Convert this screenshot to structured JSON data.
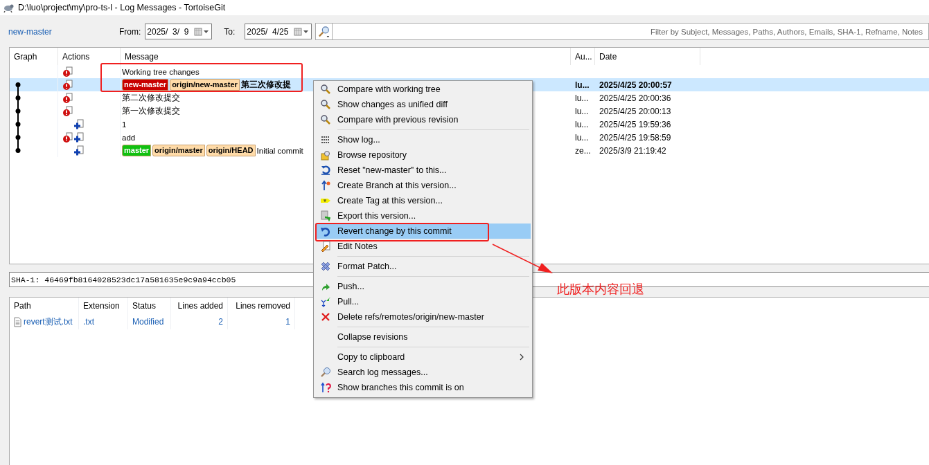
{
  "window": {
    "title": "D:\\luo\\project\\my\\pro-ts-l - Log Messages - TortoiseGit"
  },
  "toolbar": {
    "branch": "new-master",
    "from_label": "From:",
    "from_value": "2025/  3/  9",
    "to_label": "To:",
    "to_value": "2025/  4/25",
    "search": {
      "placeholder": "Filter by Subject, Messages, Paths, Authors, Emails, SHA-1, Refname, Notes"
    }
  },
  "log": {
    "columns": [
      "Graph",
      "Actions",
      "Message",
      "Au...",
      "Date"
    ],
    "rows": [
      {
        "graph_node": false,
        "modified": true,
        "added": false,
        "refs": [],
        "message": "Working tree changes",
        "author": "",
        "date": "",
        "selected": false
      },
      {
        "graph_node": true,
        "modified": true,
        "added": false,
        "refs": [
          {
            "name": "new-master",
            "color": "#c80000"
          },
          {
            "name": "origin/new-master",
            "color": "#ffdba8"
          }
        ],
        "message": "第三次修改提",
        "author": "lu...",
        "date": "2025/4/25 20:00:57",
        "selected": true
      },
      {
        "graph_node": true,
        "modified": true,
        "added": false,
        "refs": [],
        "message": "第二次修改提交",
        "author": "lu...",
        "date": "2025/4/25 20:00:36",
        "selected": false
      },
      {
        "graph_node": true,
        "modified": true,
        "added": false,
        "refs": [],
        "message": "第一次修改提交",
        "author": "lu...",
        "date": "2025/4/25 20:00:13",
        "selected": false
      },
      {
        "graph_node": true,
        "modified": false,
        "added": true,
        "refs": [],
        "message": "1",
        "author": "lu...",
        "date": "2025/4/25 19:59:36",
        "selected": false
      },
      {
        "graph_node": true,
        "modified": true,
        "added": true,
        "refs": [],
        "message": "add",
        "author": "lu...",
        "date": "2025/4/25 19:58:59",
        "selected": false
      },
      {
        "graph_node": true,
        "modified": false,
        "added": true,
        "refs": [
          {
            "name": "master",
            "color": "#10c010"
          },
          {
            "name": "origin/master",
            "color": "#ffdba8"
          },
          {
            "name": "origin/HEAD",
            "color": "#ffdba8"
          }
        ],
        "message": "Initial commit",
        "author": "ze...",
        "date": "2025/3/9 21:19:42",
        "selected": false
      }
    ]
  },
  "sha": "SHA-1: 46469fb8164028523dc17a581635e9c9a94ccb05",
  "files": {
    "columns": [
      "Path",
      "Extension",
      "Status",
      "Lines added",
      "Lines removed"
    ],
    "rows": [
      {
        "path": "revert测试.txt",
        "extension": ".txt",
        "status": "Modified",
        "lines_added": "2",
        "lines_removed": "1"
      }
    ]
  },
  "context_menu": [
    {
      "kind": "item",
      "label": "Compare with working tree",
      "selected": false
    },
    {
      "kind": "item",
      "label": "Show changes as unified diff",
      "selected": false
    },
    {
      "kind": "item",
      "label": "Compare with previous revision",
      "selected": false
    },
    {
      "kind": "separator"
    },
    {
      "kind": "item",
      "label": "Show log...",
      "selected": false
    },
    {
      "kind": "item",
      "label": "Browse repository",
      "selected": false
    },
    {
      "kind": "item",
      "label": "Reset \"new-master\" to this...",
      "selected": false
    },
    {
      "kind": "item",
      "label": "Create Branch at this version...",
      "selected": false
    },
    {
      "kind": "item",
      "label": "Create Tag at this version...",
      "selected": false
    },
    {
      "kind": "item",
      "label": "Export this version...",
      "selected": false
    },
    {
      "kind": "item",
      "label": "Revert change by this commit",
      "selected": true
    },
    {
      "kind": "item",
      "label": "Edit Notes",
      "selected": false
    },
    {
      "kind": "separator"
    },
    {
      "kind": "item",
      "label": "Format Patch...",
      "selected": false
    },
    {
      "kind": "separator"
    },
    {
      "kind": "item",
      "label": "Push...",
      "selected": false
    },
    {
      "kind": "item",
      "label": "Pull...",
      "selected": false
    },
    {
      "kind": "item",
      "label": "Delete refs/remotes/origin/new-master",
      "selected": false
    },
    {
      "kind": "separator"
    },
    {
      "kind": "item",
      "label": "Collapse revisions",
      "selected": false
    },
    {
      "kind": "separator"
    },
    {
      "kind": "item",
      "label": "Copy to clipboard",
      "selected": false,
      "submenu": true
    },
    {
      "kind": "item",
      "label": "Search log messages...",
      "selected": false
    },
    {
      "kind": "item",
      "label": "Show branches this commit is on",
      "selected": false
    }
  ],
  "annotation": {
    "note": "此版本内容回退"
  }
}
